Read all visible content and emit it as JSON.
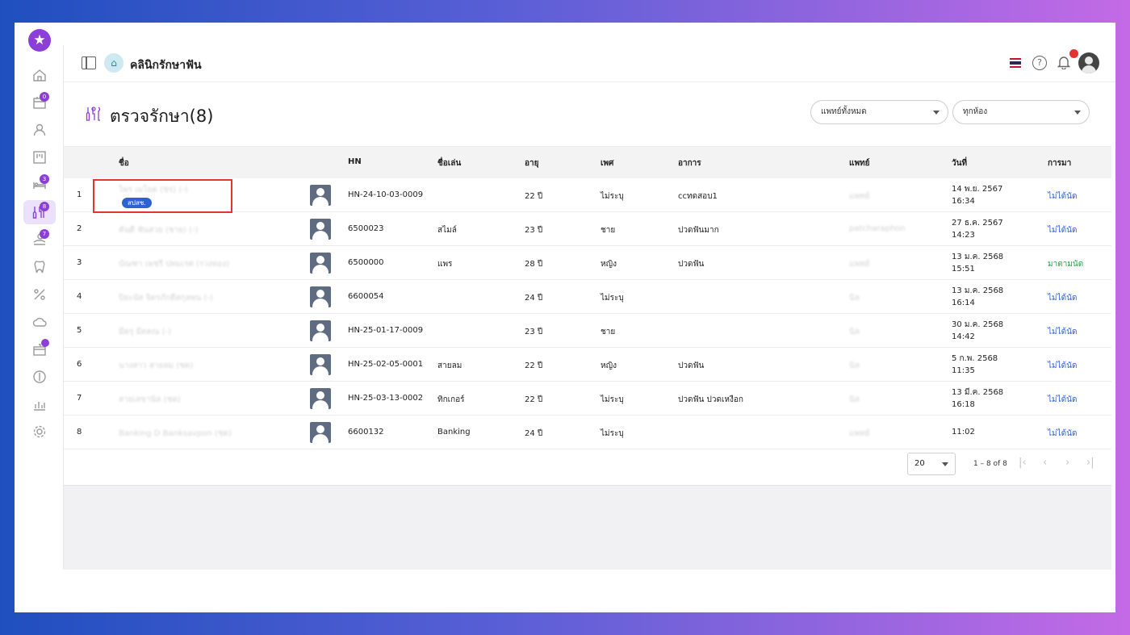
{
  "header": {
    "clinic_name": "คลินิกรักษาฟัน"
  },
  "sidebar": {
    "items": [
      {
        "name": "home",
        "badge": ""
      },
      {
        "name": "calendar",
        "badge": "0"
      },
      {
        "name": "patient",
        "badge": ""
      },
      {
        "name": "queue-board",
        "badge": ""
      },
      {
        "name": "bed",
        "badge": "3"
      },
      {
        "name": "treatment",
        "badge": "8"
      },
      {
        "name": "payment",
        "badge": "7"
      },
      {
        "name": "tooth",
        "badge": ""
      },
      {
        "name": "discount",
        "badge": ""
      },
      {
        "name": "cloud",
        "badge": ""
      },
      {
        "name": "inventory",
        "badge": ""
      },
      {
        "name": "finance",
        "badge": ""
      },
      {
        "name": "report",
        "badge": ""
      },
      {
        "name": "settings",
        "badge": ""
      }
    ]
  },
  "page": {
    "title": "ตรวจรักษา(8)",
    "filter_doctor": "แพทย์ทั้งหมด",
    "filter_room": "ทุกห้อง"
  },
  "table": {
    "headers": {
      "name": "ชื่อ",
      "hn": "HN",
      "nickname": "ชื่อเล่น",
      "age": "อายุ",
      "sex": "เพศ",
      "symptom": "อาการ",
      "doctor": "แพทย์",
      "date": "วันที่",
      "arrival": "การมา"
    },
    "rows": [
      {
        "no": "1",
        "name": "ไพร เมโยต (ชร) (-)",
        "tag": "สปสช.",
        "hn": "HN-24-10-03-0009",
        "nickname": "",
        "age": "22 ปี",
        "sex": "ไม่ระบุ",
        "symptom": "ccทดสอบ1",
        "doctor": "แพทย์",
        "date": "14 พ.ย. 2567",
        "time": "16:34",
        "arrival": "ไม่ได้นัด",
        "arrival_ok": false
      },
      {
        "no": "2",
        "name": "คันดี ฟันสวย (ชาย) (-)",
        "tag": "",
        "hn": "6500023",
        "nickname": "สไมล์",
        "age": "23 ปี",
        "sex": "ชาย",
        "symptom": "ปวดฟันมาก",
        "doctor": "patcharaphon",
        "date": "27 ธ.ค. 2567",
        "time": "14:23",
        "arrival": "ไม่ได้นัด",
        "arrival_ok": false
      },
      {
        "no": "3",
        "name": "บัณฑา เพชรี ปทมเรศ (รวงทอง)",
        "tag": "",
        "hn": "6500000",
        "nickname": "แพร",
        "age": "28 ปี",
        "sex": "หญิง",
        "symptom": "ปวดฟัน",
        "doctor": "แพทย์",
        "date": "13 ม.ค. 2568",
        "time": "15:51",
        "arrival": "มาตามนัด",
        "arrival_ok": true
      },
      {
        "no": "4",
        "name": "ปิยะนัส จิตรภักดีสกุลพน (-)",
        "tag": "",
        "hn": "6600054",
        "nickname": "",
        "age": "24 ปี",
        "sex": "ไม่ระบุ",
        "symptom": "",
        "doctor": "นิล",
        "date": "13 ม.ค. 2568",
        "time": "16:14",
        "arrival": "ไม่ได้นัด",
        "arrival_ok": false
      },
      {
        "no": "5",
        "name": "มีตรุ มีตตณ (-)",
        "tag": "",
        "hn": "HN-25-01-17-0009",
        "nickname": "",
        "age": "23 ปี",
        "sex": "ชาย",
        "symptom": "",
        "doctor": "นิล",
        "date": "30 ม.ค. 2568",
        "time": "14:42",
        "arrival": "ไม่ได้นัด",
        "arrival_ok": false
      },
      {
        "no": "6",
        "name": "นางสาว สายลม (ชด)",
        "tag": "",
        "hn": "HN-25-02-05-0001",
        "nickname": "สายลม",
        "age": "22 ปี",
        "sex": "หญิง",
        "symptom": "ปวดฟัน",
        "doctor": "นิล",
        "date": "5 ก.พ. 2568",
        "time": "11:35",
        "arrival": "ไม่ได้นัด",
        "arrival_ok": false
      },
      {
        "no": "7",
        "name": "สายเลขานิล (ชด)",
        "tag": "",
        "hn": "HN-25-03-13-0002",
        "nickname": "ทิกเกอร์",
        "age": "22 ปี",
        "sex": "ไม่ระบุ",
        "symptom": "ปวดฟัน ปวดเหงือก",
        "doctor": "นิล",
        "date": "13 มี.ค. 2568",
        "time": "16:18",
        "arrival": "ไม่ได้นัด",
        "arrival_ok": false
      },
      {
        "no": "8",
        "name": "Banking D Banksavpon (ชด)",
        "tag": "",
        "hn": "6600132",
        "nickname": "Banking",
        "age": "24 ปี",
        "sex": "ไม่ระบุ",
        "symptom": "",
        "doctor": "แพทย์",
        "date": "",
        "time": "11:02",
        "arrival": "ไม่ได้นัด",
        "arrival_ok": false
      }
    ]
  },
  "pagination": {
    "page_size": "20",
    "range": "1 – 8 of 8"
  },
  "colors": {
    "accent": "#8c3fd6",
    "link_blue": "#2d62d1",
    "ok_green": "#27a04a",
    "highlight_red": "#e8322f"
  }
}
